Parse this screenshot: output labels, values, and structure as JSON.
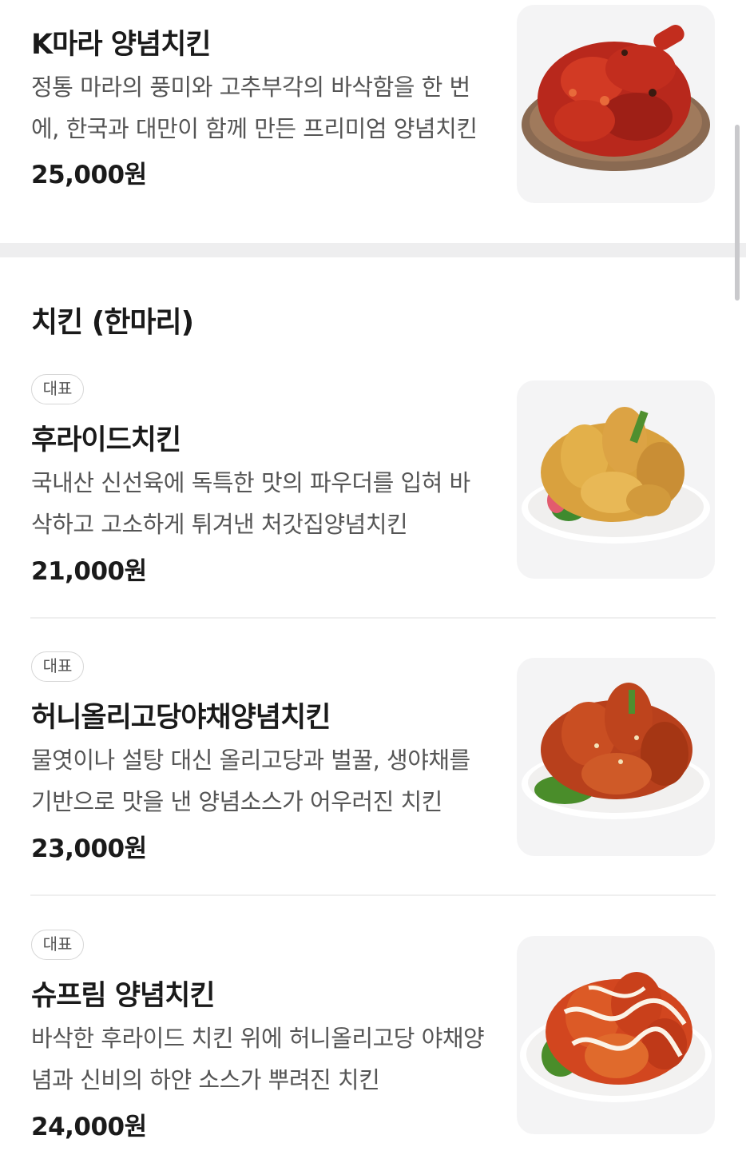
{
  "top_item": {
    "name": "K마라 양념치킨",
    "description": "정통 마라의 풍미와 고추부각의 바삭함을 한 번에, 한국과 대만이 함께 만든 프리미엄 양념치킨",
    "price": "25,000원",
    "image": "k-mala-chicken-photo"
  },
  "section": {
    "title": "치킨 (한마리)",
    "items": [
      {
        "badge": "대표",
        "name": "후라이드치킨",
        "description": "국내산 신선육에 독특한 맛의 파우더를 입혀 바삭하고 고소하게 튀겨낸 처갓집양념치킨",
        "price": "21,000원",
        "image": "fried-chicken-photo"
      },
      {
        "badge": "대표",
        "name": "허니올리고당야채양념치킨",
        "description": "물엿이나 설탕 대신 올리고당과 벌꿀, 생야채를 기반으로 맛을 낸 양념소스가 어우러진 치킨",
        "price": "23,000원",
        "image": "honey-seasoned-chicken-photo"
      },
      {
        "badge": "대표",
        "name": "슈프림 양념치킨",
        "description": "바삭한 후라이드 치킨 위에 허니올리고당 야채양념과 신비의 하얀 소스가 뿌려진 치킨",
        "price": "24,000원",
        "image": "supreme-chicken-photo"
      }
    ]
  },
  "colors": {
    "background": "#ffffff",
    "separator": "#eeeeef",
    "thumb_bg": "#f4f4f5",
    "text": "#1a1a1a",
    "muted": "#555555"
  }
}
